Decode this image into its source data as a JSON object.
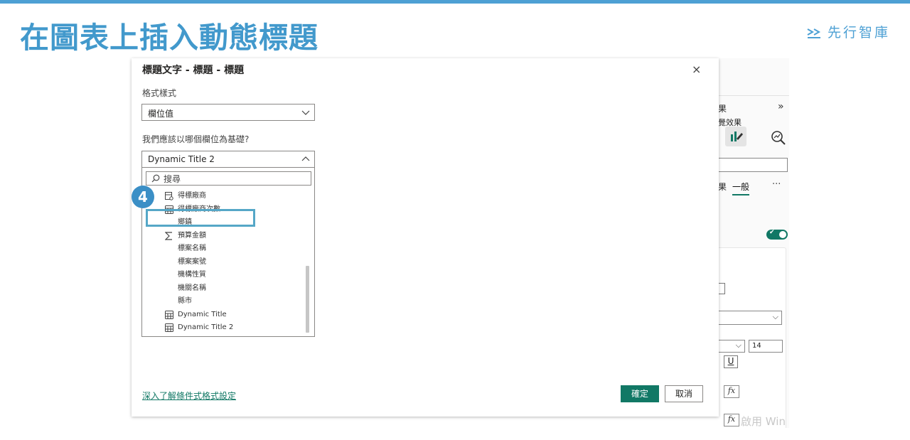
{
  "slide": {
    "title": "在圖表上插入動態標題",
    "brand": "先行智庫",
    "step_number": "4"
  },
  "dialog": {
    "title": "標題文字 - 標題 - 標題",
    "close": "×",
    "format_label": "格式樣式",
    "format_value": "欄位值",
    "field_question": "我們應該以哪個欄位為基礎?",
    "field_value": "Dynamic Title 2",
    "search_placeholder": "搜尋",
    "fields": [
      {
        "label": "得標廠商",
        "icon": "table-key-icon"
      },
      {
        "label": "得標廠商次數",
        "icon": "calculator-icon"
      },
      {
        "label": "鄉鎮",
        "icon": ""
      },
      {
        "label": "預算金額",
        "icon": "sigma-icon"
      },
      {
        "label": "標案名稱",
        "icon": ""
      },
      {
        "label": "標案案號",
        "icon": ""
      },
      {
        "label": "機構性質",
        "icon": ""
      },
      {
        "label": "機關名稱",
        "icon": ""
      },
      {
        "label": "縣市",
        "icon": ""
      },
      {
        "label": "Dynamic Title",
        "icon": "calculator-icon"
      },
      {
        "label": "Dynamic Title 2",
        "icon": "calculator-icon"
      }
    ],
    "learn_link": "深入了解條件式格式設定",
    "ok": "確定",
    "cancel": "取消"
  },
  "background_panel": {
    "heading_fragment": "果",
    "expand": "»",
    "sub_fragment": "覺效果",
    "tab_fragment": "果",
    "tab_general": "一般",
    "more": "···",
    "font_size": "14",
    "underline": "U",
    "fx": "fx",
    "watermark": "啟用 Win"
  },
  "colors": {
    "accent_blue": "#4299cc",
    "pbi_green": "#117865",
    "highlight": "#55a7c7"
  }
}
